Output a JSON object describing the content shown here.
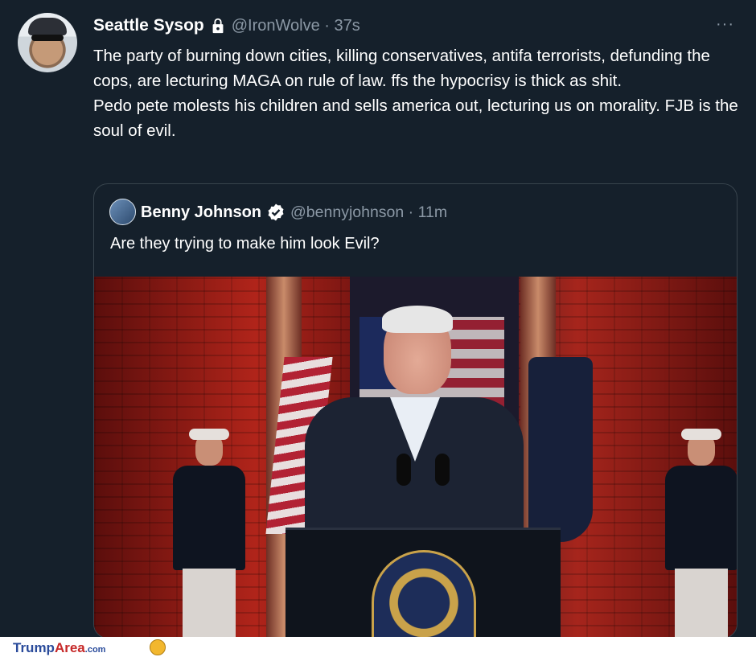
{
  "tweet": {
    "author_name": "Seattle Sysop",
    "lock_icon": "lock-icon",
    "handle_time": "@IronWolve · 37s",
    "more_label": "···",
    "body_lines": [
      "The party of burning down cities, killing conservatives, antifa terrorists, defunding the cops, are lecturing MAGA on rule of law.  ffs the hypocrisy is thick as shit.",
      "Pedo pete molests his children and sells america out, lecturing us on morality. FJB is the soul of evil."
    ]
  },
  "quoted": {
    "author_name": "Benny Johnson",
    "verified_icon": "verified-badge-icon",
    "handle_time": "@bennyjohnson · 11m",
    "text": "Are they trying to make him look Evil?"
  },
  "footer": {
    "brand_part1": "Trump",
    "brand_part2": "Area",
    "brand_part3": ".com"
  },
  "colors": {
    "background": "#15202b",
    "secondary_text": "#8b98a5",
    "border": "#38444d",
    "brand_blue": "#2a4b9b",
    "brand_red": "#c62828"
  }
}
